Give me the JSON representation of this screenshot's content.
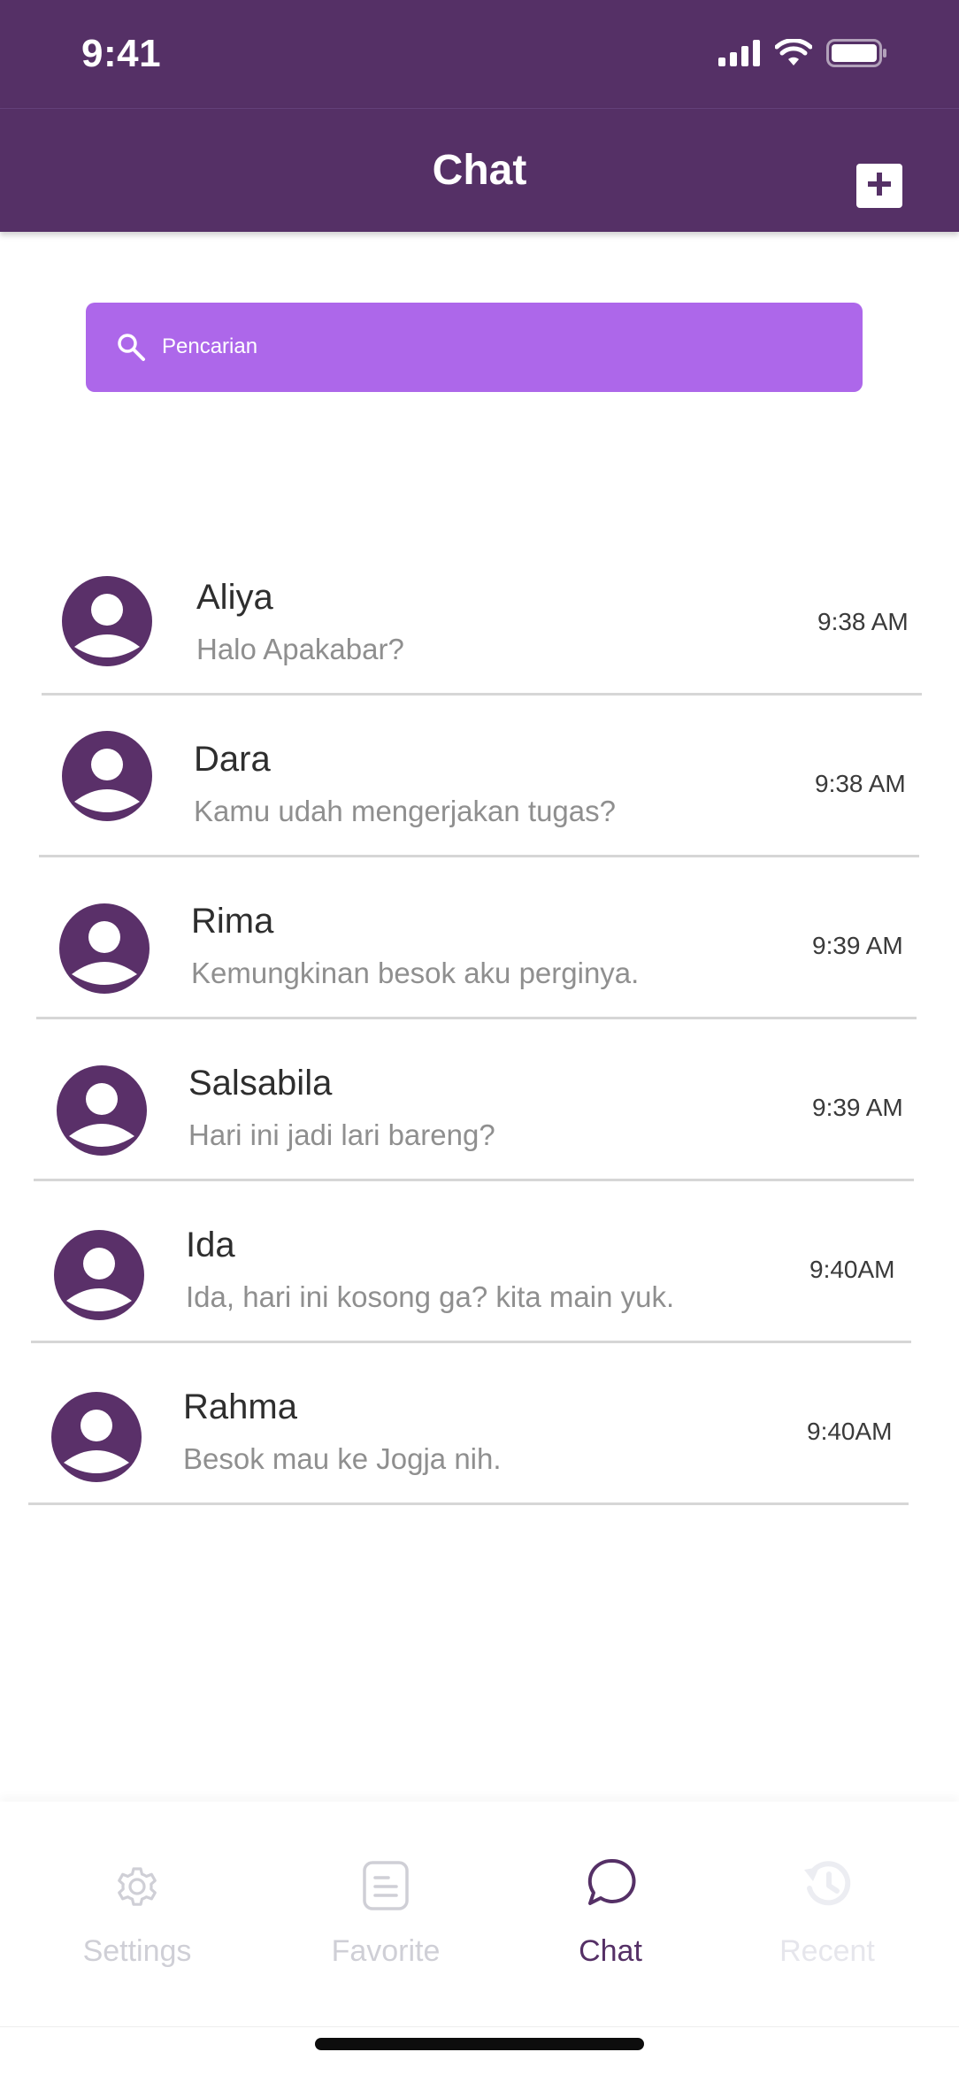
{
  "status_bar": {
    "time": "9:41"
  },
  "header": {
    "title": "Chat"
  },
  "search": {
    "placeholder": "Pencarian"
  },
  "chats": [
    {
      "name": "Aliya",
      "message": "Halo Apakabar?",
      "time": "9:38 AM"
    },
    {
      "name": "Dara",
      "message": "Kamu udah mengerjakan tugas?",
      "time": "9:38 AM"
    },
    {
      "name": "Rima",
      "message": "Kemungkinan besok aku perginya.",
      "time": "9:39 AM"
    },
    {
      "name": "Salsabila",
      "message": "Hari ini jadi lari bareng?",
      "time": "9:39 AM"
    },
    {
      "name": "Ida",
      "message": "Ida, hari ini kosong ga? kita main yuk.",
      "time": "9:40AM"
    },
    {
      "name": "Rahma",
      "message": "Besok mau ke Jogja nih.",
      "time": "9:40AM"
    }
  ],
  "nav": {
    "items": [
      {
        "label": "Settings",
        "icon": "gear-icon",
        "active": false
      },
      {
        "label": "Favorite",
        "icon": "document-icon",
        "active": false
      },
      {
        "label": "Chat",
        "icon": "chat-bubble-icon",
        "active": true
      },
      {
        "label": "Recent",
        "icon": "history-icon",
        "active": false
      }
    ]
  },
  "colors": {
    "primary": "#553066",
    "search_bg": "#ad67ea",
    "avatar": "#5a3069",
    "nav_inactive": "#cfcfd6",
    "nav_active": "#553066"
  }
}
